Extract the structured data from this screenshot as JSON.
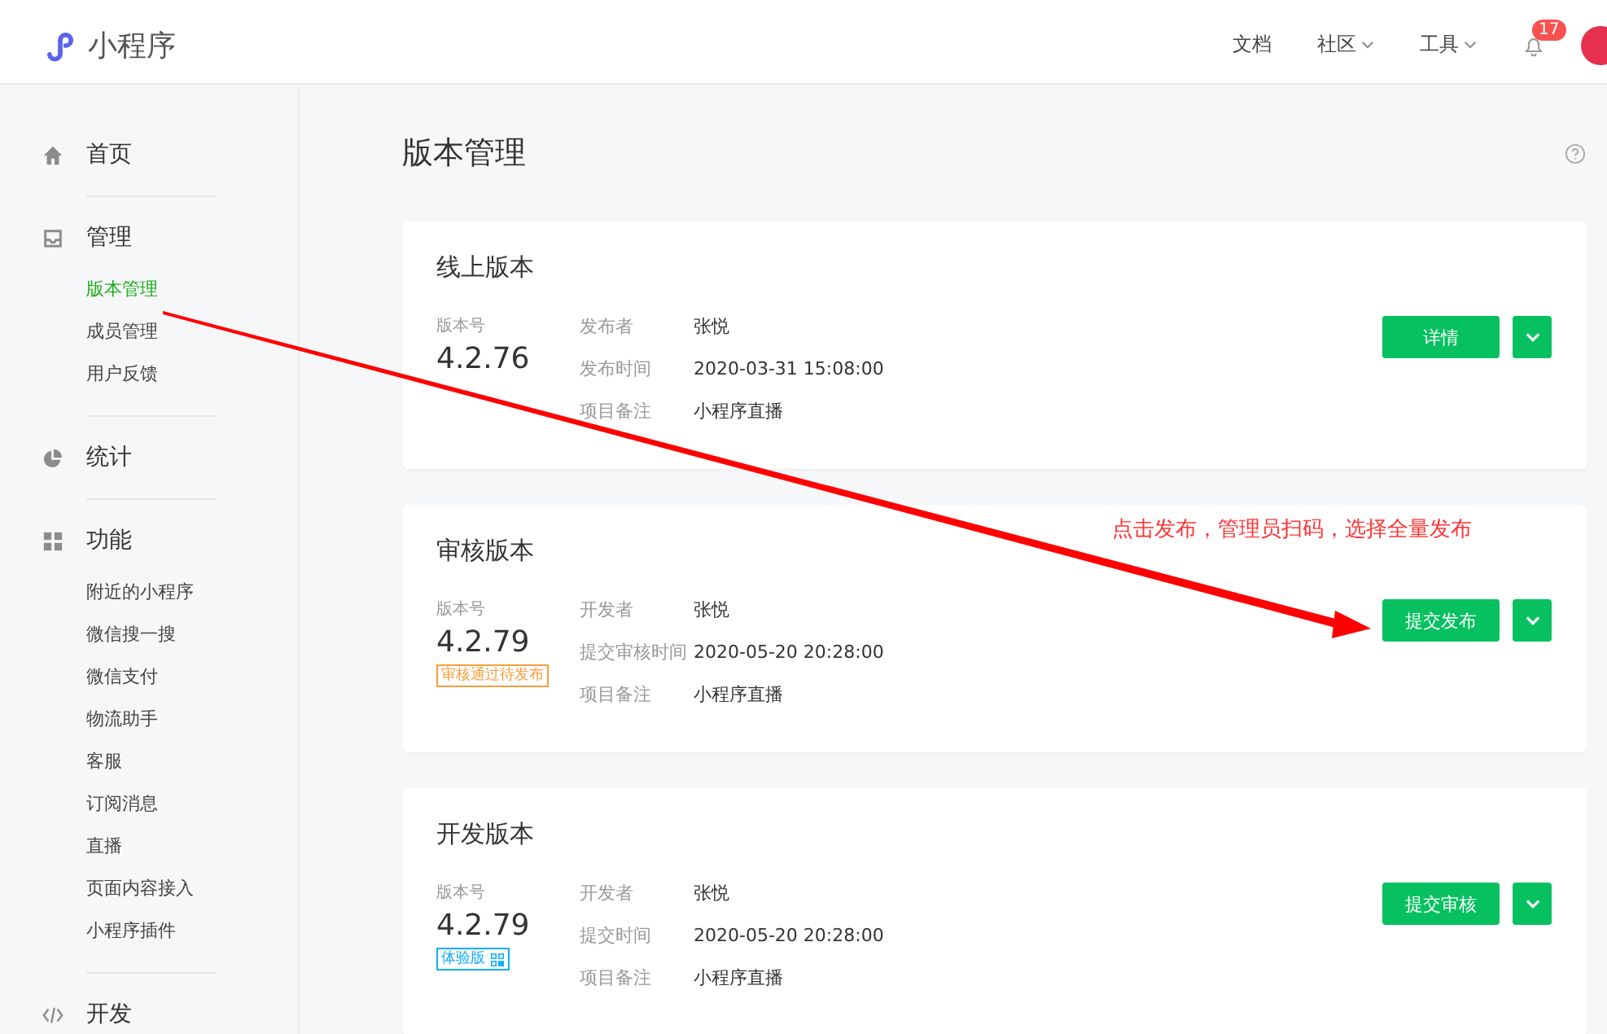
{
  "header": {
    "logo_text": "小程序",
    "nav": [
      {
        "label": "文档",
        "dropdown": false
      },
      {
        "label": "社区",
        "dropdown": true
      },
      {
        "label": "工具",
        "dropdown": true
      }
    ],
    "notifications": {
      "count": "17"
    }
  },
  "sidebar": {
    "sections": [
      {
        "label": "首页"
      },
      {
        "label": "管理",
        "items": [
          {
            "label": "版本管理",
            "selected": true
          },
          {
            "label": "成员管理",
            "selected": false
          },
          {
            "label": "用户反馈",
            "selected": false
          }
        ]
      },
      {
        "label": "统计"
      },
      {
        "label": "功能",
        "items": [
          {
            "label": "附近的小程序",
            "selected": false
          },
          {
            "label": "微信搜一搜",
            "selected": false
          },
          {
            "label": "微信支付",
            "selected": false
          },
          {
            "label": "物流助手",
            "selected": false
          },
          {
            "label": "客服",
            "selected": false
          },
          {
            "label": "订阅消息",
            "selected": false
          },
          {
            "label": "直播",
            "selected": false
          },
          {
            "label": "页面内容接入",
            "selected": false
          },
          {
            "label": "小程序插件",
            "selected": false
          }
        ]
      },
      {
        "label": "开发"
      }
    ]
  },
  "page": {
    "title": "版本管理"
  },
  "cards": [
    {
      "title": "线上版本",
      "version_label": "版本号",
      "version": "4.2.76",
      "fields": [
        {
          "label": "发布者",
          "value": "张悦"
        },
        {
          "label": "发布时间",
          "value": "2020-03-31 15:08:00"
        },
        {
          "label": "项目备注",
          "value": "小程序直播"
        }
      ],
      "button": "详情"
    },
    {
      "title": "审核版本",
      "version_label": "版本号",
      "version": "4.2.79",
      "tag": {
        "text": "审核通过待发布",
        "kind": "warning"
      },
      "fields": [
        {
          "label": "开发者",
          "value": "张悦"
        },
        {
          "label": "提交审核时间",
          "value": "2020-05-20 20:28:00"
        },
        {
          "label": "项目备注",
          "value": "小程序直播"
        }
      ],
      "button": "提交发布"
    },
    {
      "title": "开发版本",
      "version_label": "版本号",
      "version": "4.2.79",
      "tag": {
        "text": "体验版",
        "kind": "info",
        "qr": true
      },
      "fields": [
        {
          "label": "开发者",
          "value": "张悦"
        },
        {
          "label": "提交时间",
          "value": "2020-05-20 20:28:00"
        },
        {
          "label": "项目备注",
          "value": "小程序直播"
        }
      ],
      "button": "提交审核"
    }
  ],
  "annotation": {
    "text": "点击发布，管理员扫码，选择全量发布"
  }
}
